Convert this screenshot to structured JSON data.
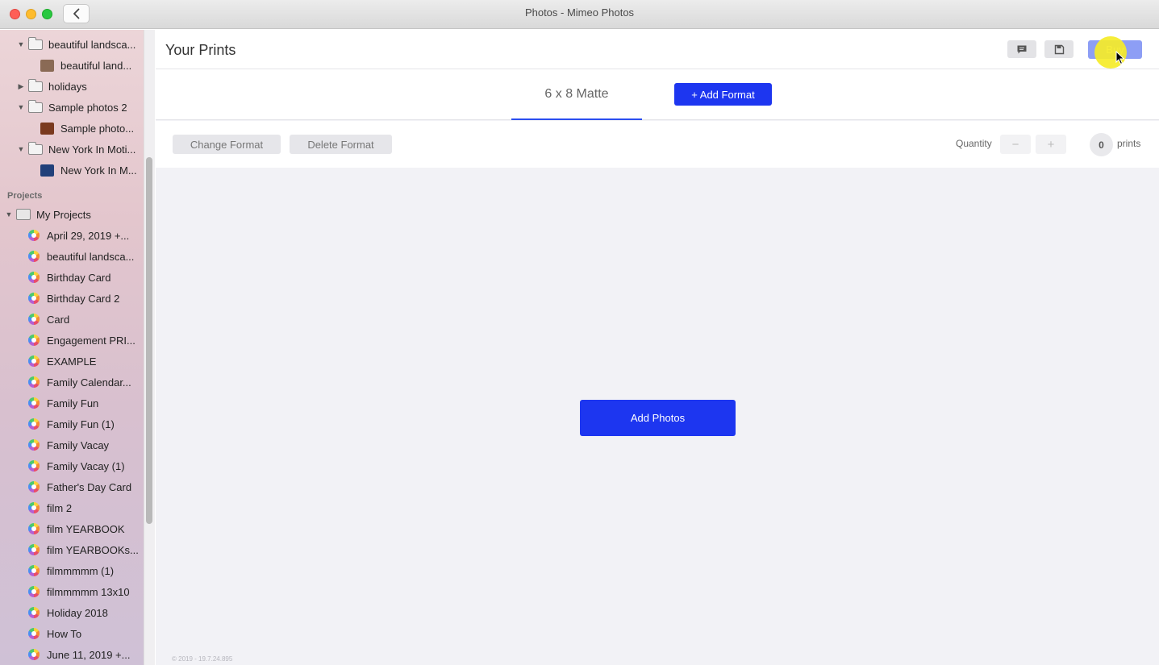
{
  "window": {
    "title": "Photos - Mimeo Photos"
  },
  "sidebar": {
    "library_items": [
      {
        "label": "beautiful landsca...",
        "kind": "folder",
        "expanded": true
      },
      {
        "label": "beautiful land...",
        "kind": "album",
        "thumb_color": "#8a6a55"
      },
      {
        "label": "holidays",
        "kind": "folder",
        "expanded": false
      },
      {
        "label": "Sample photos 2",
        "kind": "folder",
        "expanded": true
      },
      {
        "label": "Sample photo...",
        "kind": "album",
        "thumb_color": "#7a3a1f"
      },
      {
        "label": "New York In Moti...",
        "kind": "folder",
        "expanded": true
      },
      {
        "label": "New York In M...",
        "kind": "album",
        "thumb_color": "#21407a"
      }
    ],
    "projects_heading": "Projects",
    "projects_root": "My Projects",
    "projects": [
      "April 29, 2019 +...",
      "beautiful landsca...",
      "Birthday Card",
      "Birthday Card 2",
      "Card",
      "Engagement PRI...",
      "EXAMPLE",
      "Family Calendar...",
      "Family Fun",
      "Family Fun (1)",
      "Family Vacay",
      "Family Vacay (1)",
      "Father's Day Card",
      "film 2",
      "film YEARBOOK",
      "film YEARBOOKs...",
      "filmmmmm (1)",
      "filmmmmm 13x10",
      "Holiday 2018",
      "How To",
      "June 11, 2019 +..."
    ]
  },
  "header": {
    "title": "Your Prints",
    "chat_icon": "chat-icon",
    "save_icon": "save-icon",
    "buy_label": "Buy"
  },
  "formats": {
    "active_tab": "6 x 8 Matte",
    "add_format_label": "+ Add Format"
  },
  "actions": {
    "change_format_label": "Change Format",
    "delete_format_label": "Delete Format",
    "quantity_label": "Quantity",
    "decrement_label": "−",
    "increment_label": "+",
    "count": "0",
    "count_unit": "prints"
  },
  "content": {
    "add_photos_label": "Add Photos"
  },
  "footer": {
    "version": "© 2019 - 19.7.24.895"
  },
  "colors": {
    "accent": "#1d36f0",
    "buy": "#8d9ef5",
    "tab_underline": "#2b4ef0"
  }
}
